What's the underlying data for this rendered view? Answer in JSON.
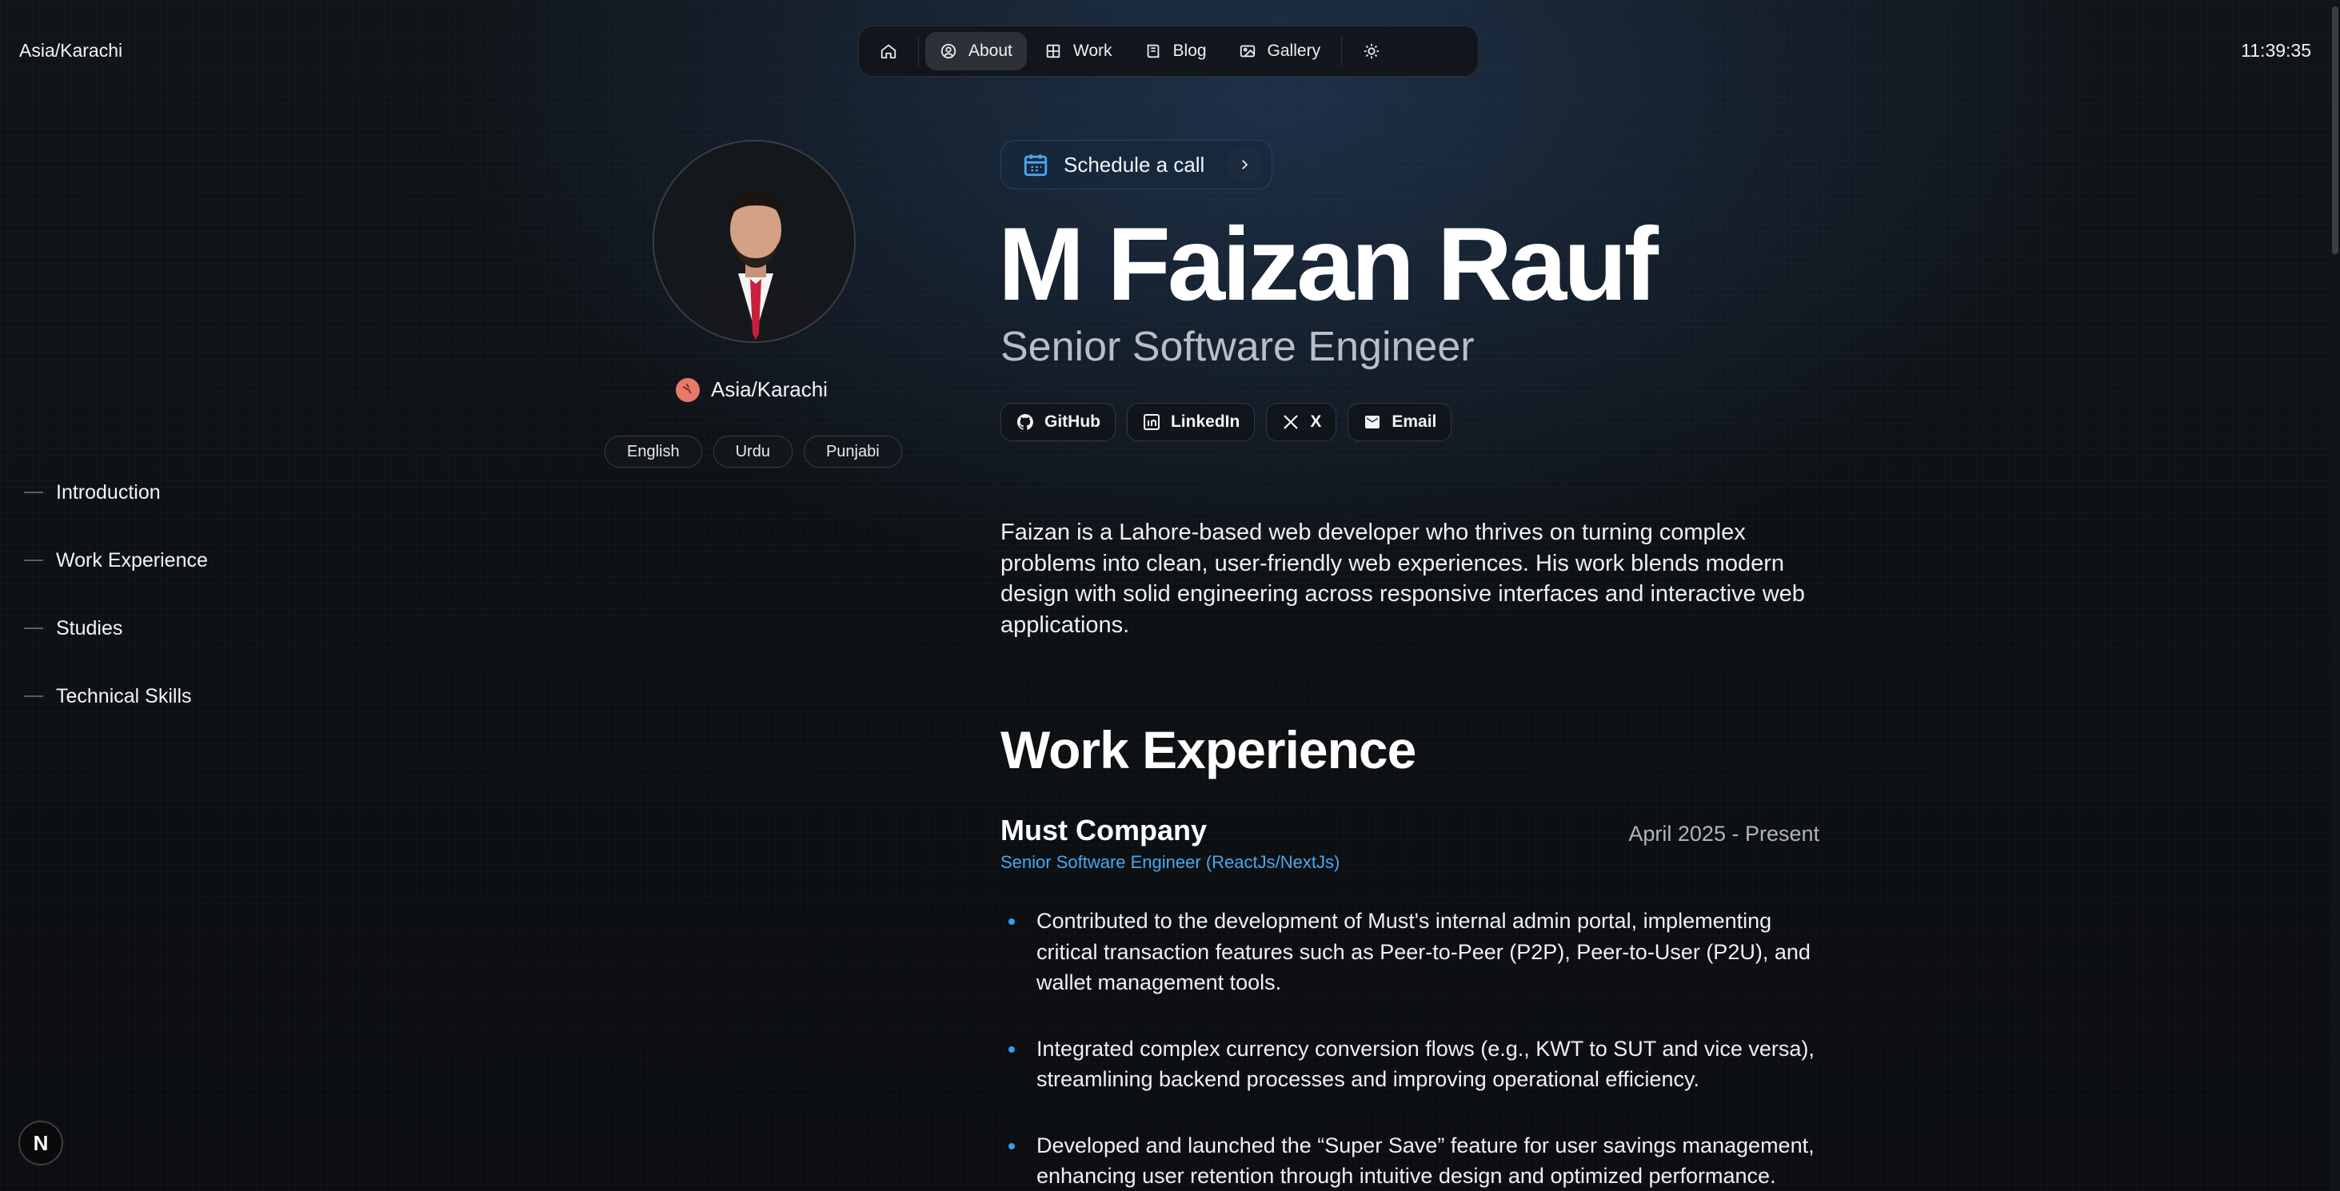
{
  "header": {
    "timezone": "Asia/Karachi",
    "clock": "11:39:35",
    "nav": [
      {
        "label": "",
        "icon": "home-icon"
      },
      {
        "label": "About",
        "icon": "user-circle-icon"
      },
      {
        "label": "Work",
        "icon": "grid-icon"
      },
      {
        "label": "Blog",
        "icon": "book-icon"
      },
      {
        "label": "Gallery",
        "icon": "image-icon"
      },
      {
        "label": "",
        "icon": "sun-icon"
      }
    ]
  },
  "profile": {
    "location": "Asia/Karachi",
    "languages": [
      "English",
      "Urdu",
      "Punjabi"
    ]
  },
  "toc": [
    "Introduction",
    "Work Experience",
    "Studies",
    "Technical Skills"
  ],
  "hero": {
    "schedule_label": "Schedule a call",
    "name": "M Faizan Rauf",
    "role": "Senior Software Engineer",
    "socials": [
      {
        "label": "GitHub",
        "icon": "github-icon"
      },
      {
        "label": "LinkedIn",
        "icon": "linkedin-icon"
      },
      {
        "label": "X",
        "icon": "x-icon"
      },
      {
        "label": "Email",
        "icon": "email-icon"
      }
    ],
    "intro": "Faizan is a Lahore-based web developer who thrives on turning complex problems into clean, user-friendly web experiences. His work blends modern design with solid engineering across responsive interfaces and interactive web applications."
  },
  "work": {
    "title": "Work Experience",
    "company": "Must Company",
    "period": "April 2025 - Present",
    "role": "Senior Software Engineer (ReactJs/NextJs)",
    "bullets": [
      "Contributed to the development of Must's internal admin portal, implementing critical transaction features such as Peer-to-Peer (P2P), Peer-to-User (P2U), and wallet management tools.",
      "Integrated complex currency conversion flows (e.g., KWT to SUT and vice versa), streamlining backend processes and improving operational efficiency.",
      "Developed and launched the “Super Save” feature for user savings management, enhancing user retention through intuitive design and optimized performance."
    ]
  },
  "badge": {
    "letter": "N"
  },
  "colors": {
    "accent": "#4aa7f0",
    "background": "#0b0d10",
    "globe": "#e87a6a"
  }
}
